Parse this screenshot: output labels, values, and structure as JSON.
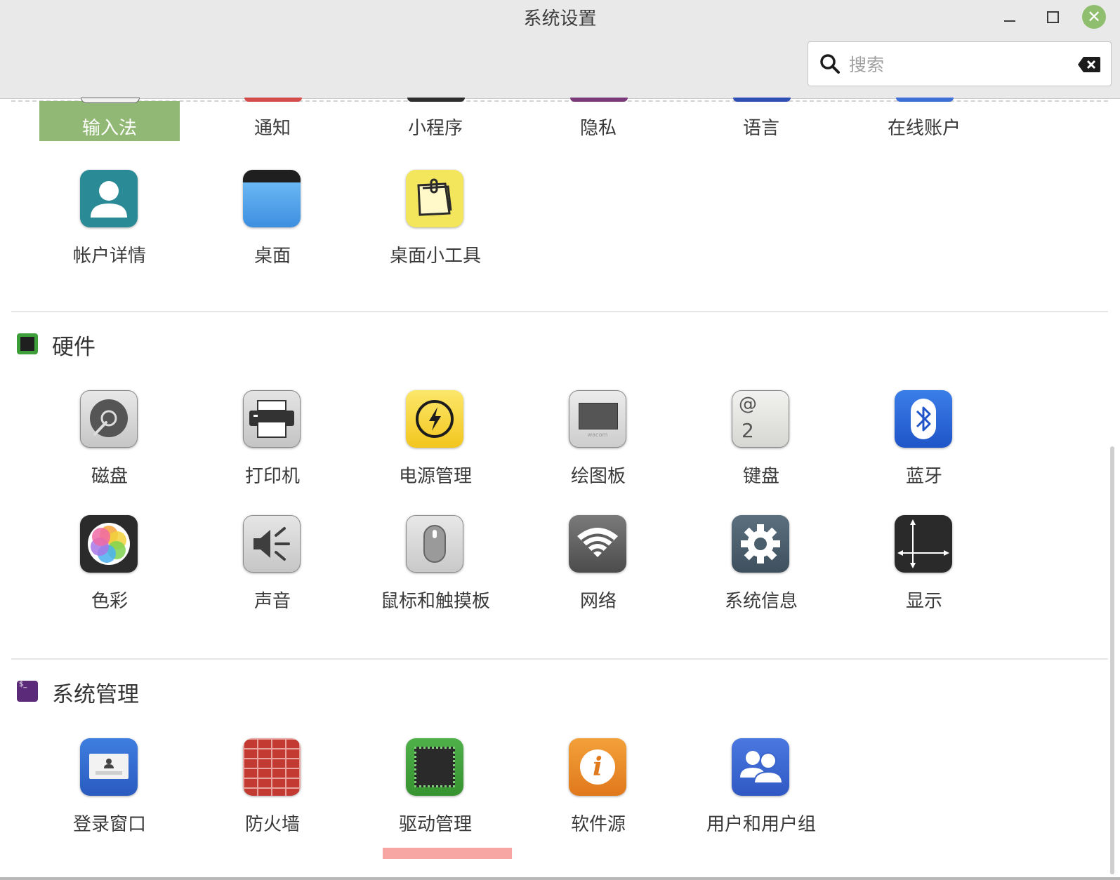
{
  "window": {
    "title": "系统设置",
    "minimize_icon": "minimize-icon",
    "maximize_icon": "maximize-icon",
    "close_icon": "close-icon",
    "close_symbol": "✕",
    "accent": "#8fbf6e"
  },
  "search": {
    "placeholder": "搜索",
    "value": ""
  },
  "top_row": [
    {
      "label": "输入法",
      "selected": true
    },
    {
      "label": "通知"
    },
    {
      "label": "小程序"
    },
    {
      "label": "隐私"
    },
    {
      "label": "语言"
    },
    {
      "label": "在线账户"
    }
  ],
  "personal": [
    {
      "label": "帐户详情",
      "icon": "account-icon"
    },
    {
      "label": "桌面",
      "icon": "desktop-icon"
    },
    {
      "label": "桌面小工具",
      "icon": "desklets-icon"
    }
  ],
  "hardware": {
    "title": "硬件",
    "icon": "chip-icon",
    "items": [
      {
        "label": "磁盘",
        "icon": "disk-icon"
      },
      {
        "label": "打印机",
        "icon": "printer-icon"
      },
      {
        "label": "电源管理",
        "icon": "power-icon"
      },
      {
        "label": "绘图板",
        "icon": "tablet-icon"
      },
      {
        "label": "键盘",
        "icon": "keyboard-icon"
      },
      {
        "label": "蓝牙",
        "icon": "bluetooth-icon"
      },
      {
        "label": "色彩",
        "icon": "color-icon"
      },
      {
        "label": "声音",
        "icon": "sound-icon"
      },
      {
        "label": "鼠标和触摸板",
        "icon": "mouse-icon"
      },
      {
        "label": "网络",
        "icon": "network-icon"
      },
      {
        "label": "系统信息",
        "icon": "gear-icon"
      },
      {
        "label": "显示",
        "icon": "display-icon"
      }
    ]
  },
  "admin": {
    "title": "系统管理",
    "icon": "terminal-icon",
    "items": [
      {
        "label": "登录窗口",
        "icon": "login-icon"
      },
      {
        "label": "防火墙",
        "icon": "firewall-icon"
      },
      {
        "label": "驱动管理",
        "icon": "driver-icon"
      },
      {
        "label": "软件源",
        "icon": "info-icon"
      },
      {
        "label": "用户和用户组",
        "icon": "users-icon"
      }
    ]
  },
  "keyboard_icon_text": {
    "at": "@",
    "two": "2"
  },
  "tablet_icon_text": "wacom",
  "terminal_icon_text": "$_",
  "info_icon_text": "i"
}
